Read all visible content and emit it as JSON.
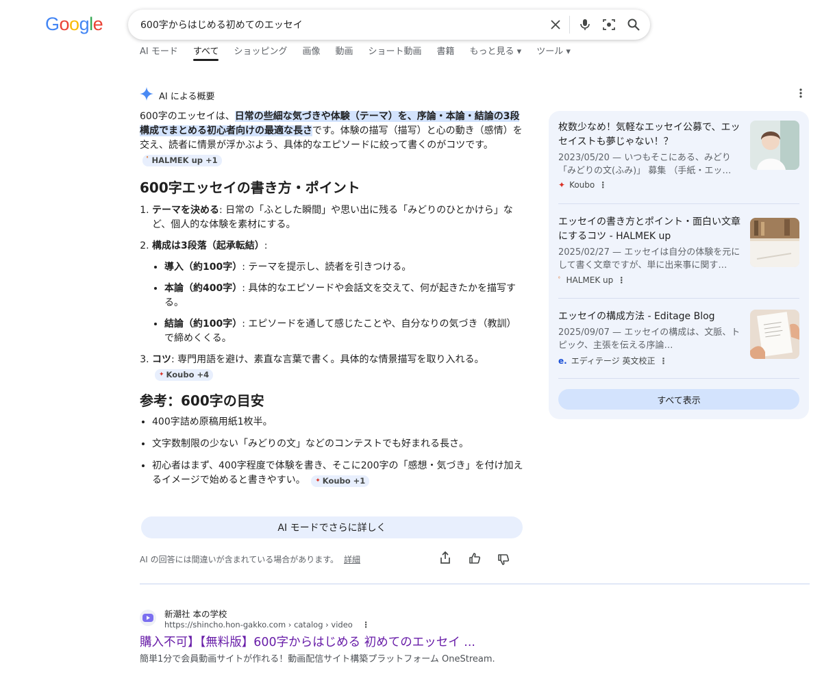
{
  "logo": "Google",
  "search": {
    "query": "600字からはじめる初めてのエッセイ"
  },
  "tabs": [
    {
      "label": "AI モード",
      "active": false
    },
    {
      "label": "すべて",
      "active": true
    },
    {
      "label": "ショッピング",
      "active": false
    },
    {
      "label": "画像",
      "active": false
    },
    {
      "label": "動画",
      "active": false
    },
    {
      "label": "ショート動画",
      "active": false
    },
    {
      "label": "書籍",
      "active": false
    },
    {
      "label": "もっと見る",
      "active": false
    },
    {
      "label": "ツール",
      "active": false
    }
  ],
  "ai_overview": {
    "heading": "AI による概要",
    "intro_pre": "600字のエッセイは、",
    "intro_highlight": "日常の些細な気づきや体験（テーマ）を、序論・本論・結論の3段構成でまとめる初心者向けの最適な長さ",
    "intro_post": "です。体験の描写（描写）と心の動き（感情）を交え、読者に情景が浮かぶよう、具体的なエピソードに絞って書くのがコツです。",
    "intro_chip": "HALMEK up +1",
    "section1_title": "600字エッセイの書き方・ポイント",
    "step1_bold": "テーマを決める",
    "step1_text": ": 日常の「ふとした瞬間」や思い出に残る「みどりのひとかけら」など、個人的な体験を素材にする。",
    "step2_bold": "構成は3段落（起承転結）",
    "step2_text": ":",
    "sub1_bold": "導入（約100字）",
    "sub1_text": ": テーマを提示し、読者を引きつける。",
    "sub2_bold": "本論（約400字）",
    "sub2_text": ": 具体的なエピソードや会話文を交えて、何が起きたかを描写する。",
    "sub3_bold": "結論（約100字）",
    "sub3_text": ": エピソードを通して感じたことや、自分なりの気づき（教訓）で締めくくる。",
    "step3_bold": "コツ",
    "step3_text": ": 専門用語を避け、素直な言葉で書く。具体的な情景描写を取り入れる。",
    "step3_chip": "Koubo +4",
    "section2_title": "参考：600字の目安",
    "ref1": "400字詰め原稿用紙1枚半。",
    "ref2": "文字数制限の少ない「みどりの文」などのコンテストでも好まれる長さ。",
    "ref3": "初心者はまず、400字程度で体験を書き、そこに200字の「感想・気づき」を付け加えるイメージで始めると書きやすい。",
    "ref3_chip": "Koubo +1",
    "more_button": "AI モードでさらに詳しく",
    "disclaimer": "AI の回答には間違いが含まれている場合があります。",
    "details_link": "詳細"
  },
  "sources": [
    {
      "title": "枚数少なめ！気軽なエッセイ公募で、エッセイストも夢じゃない！？",
      "snippet": "2023/05/20 — いつもそこにある、みどり「みどりの文(ふみ)」 募集 （手紙・エッ…",
      "site": "Koubo",
      "thumb_color": "#c9d7d3"
    },
    {
      "title": "エッセイの書き方とポイント・面白い文章にするコツ - HALMEK up",
      "snippet": "2025/02/27 — エッセイは自分の体験を元にして書く文章ですが、単に出来事に関す…",
      "site": "HALMEK up",
      "thumb_color": "#d9c3a5"
    },
    {
      "title": "エッセイの構成方法 - Editage Blog",
      "snippet": "2025/09/07 — エッセイの構成は、文脈、トピック、主張を伝える序論…",
      "site": "エディテージ 英文校正",
      "thumb_color": "#e4d9cf"
    }
  ],
  "show_all": "すべて表示",
  "result": {
    "site_name": "新潮社 本の学校",
    "url": "https://shincho.hon-gakko.com › catalog › video",
    "title": "購入不可】【無料版】600字からはじめる 初めてのエッセイ ...",
    "snippet": "簡単1分で会員動画サイトが作れる！動画配信サイト構築プラットフォーム OneStream."
  },
  "colors": {
    "accent": "#1a73e8",
    "visited_link": "#681da8",
    "panel_bg": "#f0f4fc",
    "highlight": "#d3e3fd"
  }
}
